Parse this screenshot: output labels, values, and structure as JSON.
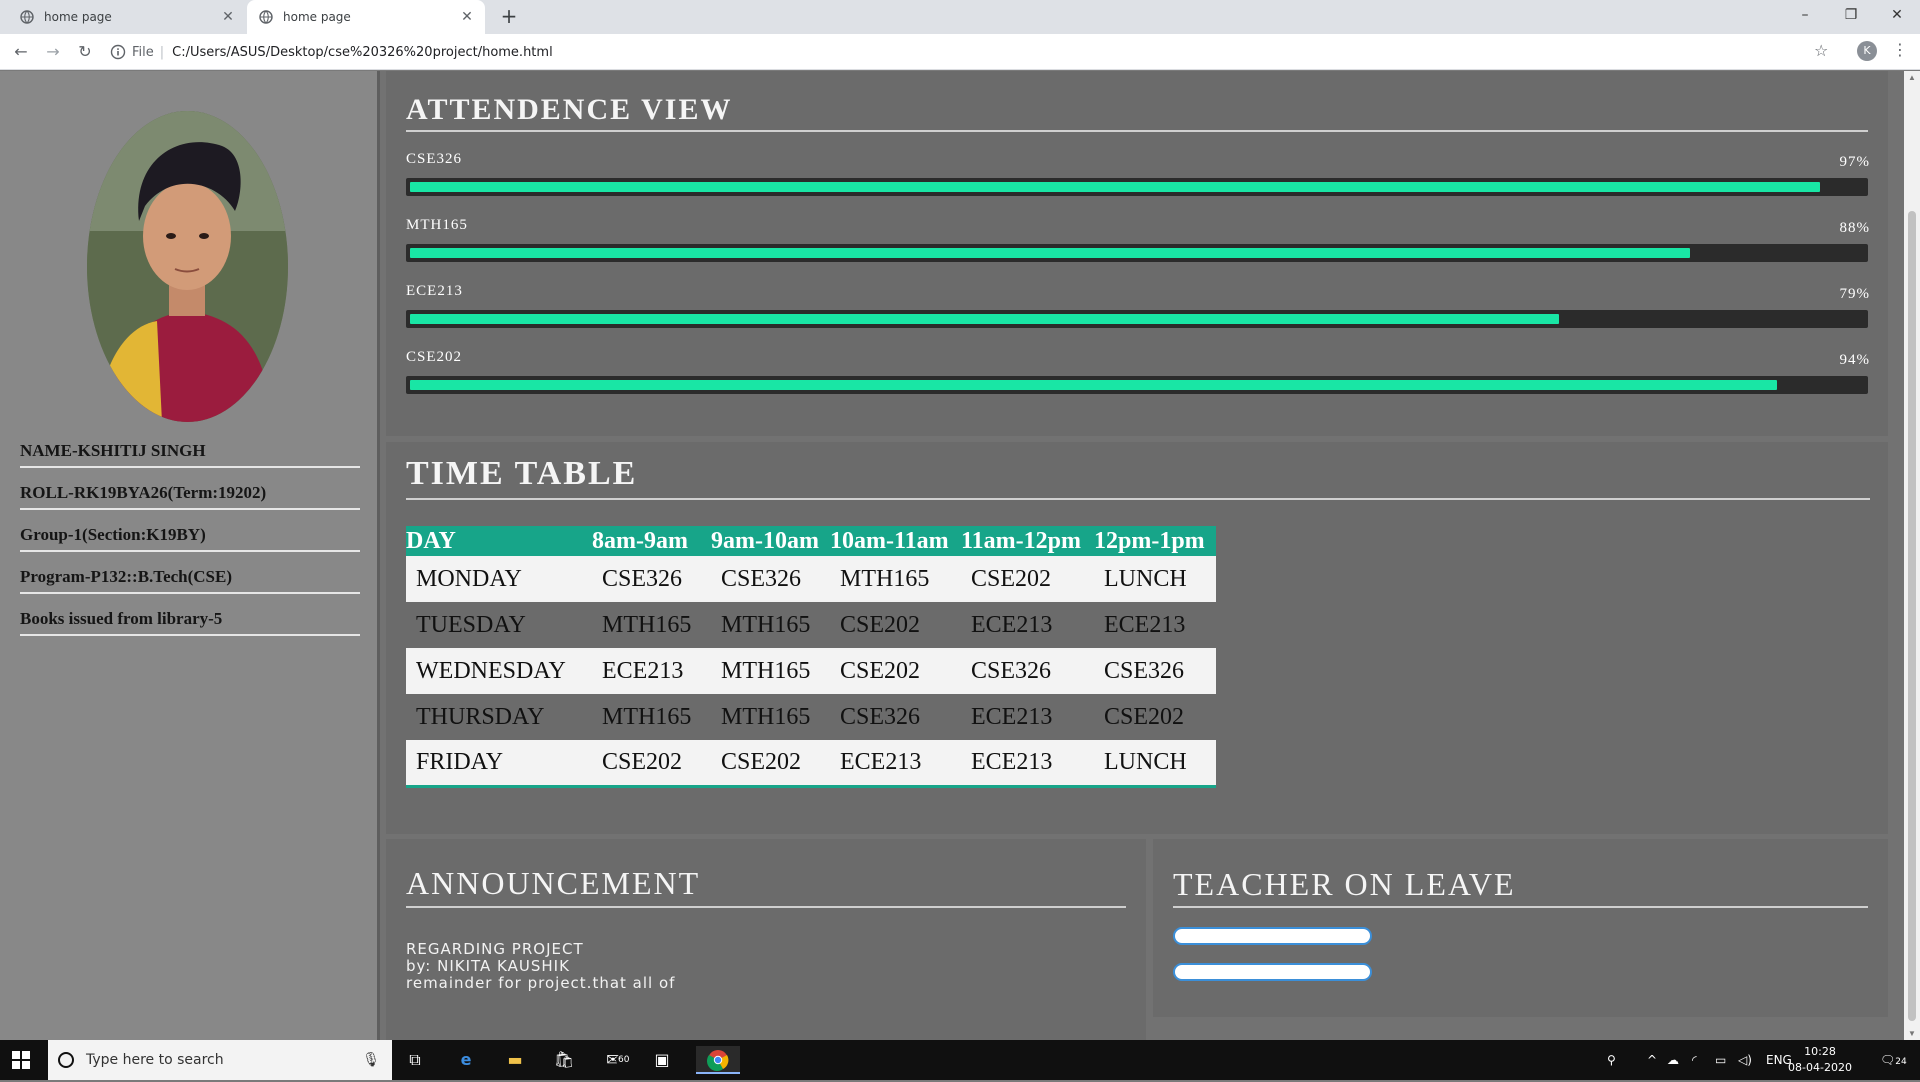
{
  "browser": {
    "tabs": [
      {
        "title": "home page",
        "active": false
      },
      {
        "title": "home page",
        "active": true
      }
    ],
    "url_prefix": "File",
    "url": "C:/Users/ASUS/Desktop/cse%20326%20project/home.html",
    "profile_initial": "K"
  },
  "profile": {
    "name": "NAME-KSHITIJ SINGH",
    "roll": "ROLL-RK19BYA26(Term:19202)",
    "group": "Group-1(Section:K19BY)",
    "program": "Program-P132::B.Tech(CSE)",
    "books": "Books issued from library-5"
  },
  "attendance": {
    "title": "ATTENDENCE VIEW",
    "items": [
      {
        "course": "CSE326",
        "percent_label": "97%",
        "percent": 97
      },
      {
        "course": "MTH165",
        "percent_label": "88%",
        "percent": 88
      },
      {
        "course": "ECE213",
        "percent_label": "79%",
        "percent": 79
      },
      {
        "course": "CSE202",
        "percent_label": "94%",
        "percent": 94
      }
    ],
    "bar_color": "#19e6a5"
  },
  "timetable": {
    "title": "TIME TABLE",
    "headers": [
      "DAY",
      "8am-9am",
      "9am-10am",
      "10am-11am",
      "11am-12pm",
      "12pm-1pm"
    ],
    "rows": [
      [
        "MONDAY",
        "CSE326",
        "CSE326",
        "MTH165",
        "CSE202",
        "LUNCH"
      ],
      [
        "TUESDAY",
        "MTH165",
        "MTH165",
        "CSE202",
        "ECE213",
        "ECE213"
      ],
      [
        "WEDNESDAY",
        "ECE213",
        "MTH165",
        "CSE202",
        "CSE326",
        "CSE326"
      ],
      [
        "THURSDAY",
        "MTH165",
        "MTH165",
        "CSE326",
        "ECE213",
        "CSE202"
      ],
      [
        "FRIDAY",
        "CSE202",
        "CSE202",
        "ECE213",
        "ECE213",
        "LUNCH"
      ]
    ],
    "header_color": "#17a589"
  },
  "announcement": {
    "title": "ANNOUNCEMENT",
    "lines": [
      "REGARDING PROJECT",
      "by: NIKITA KAUSHIK",
      "remainder for project.that all of"
    ]
  },
  "leave": {
    "title": "TEACHER ON LEAVE"
  },
  "taskbar": {
    "search_placeholder": "Type here to search",
    "mail_badge": "60",
    "language": "ENG",
    "time": "10:28",
    "date": "08-04-2020",
    "notification_count": "24"
  }
}
